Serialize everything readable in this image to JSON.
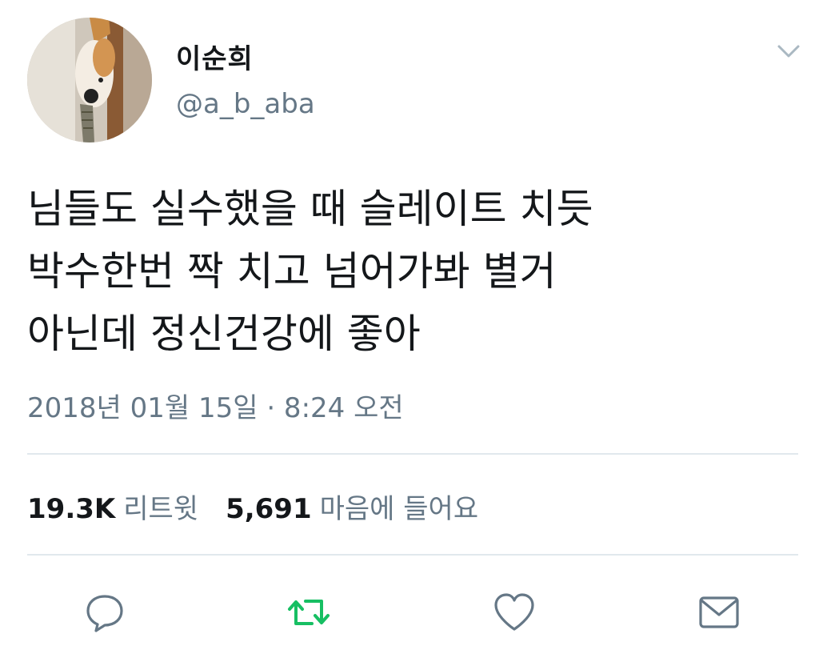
{
  "user": {
    "display_name": "이순희",
    "handle": "@a_b_aba",
    "avatar_icon": "dog-peeking-photo"
  },
  "tweet": {
    "lines": [
      "님들도 실수했을 때 슬레이트 치듯",
      "박수한번 짝 치고 넘어가봐 별거",
      "아닌데 정신건강에 좋아"
    ],
    "timestamp": "2018년 01월 15일 · 8:24 오전"
  },
  "stats": {
    "retweets_count": "19.3K",
    "retweets_label": "리트윗",
    "likes_count": "5,691",
    "likes_label": "마음에 들어요"
  },
  "actions": {
    "reply_icon": "speech-bubble-icon",
    "retweet_icon": "retweet-icon",
    "like_icon": "heart-icon",
    "dm_icon": "envelope-icon"
  },
  "colors": {
    "text": "#14171a",
    "secondary": "#657786",
    "divider": "#e1e8ed",
    "retweet_green": "#17bf63"
  }
}
